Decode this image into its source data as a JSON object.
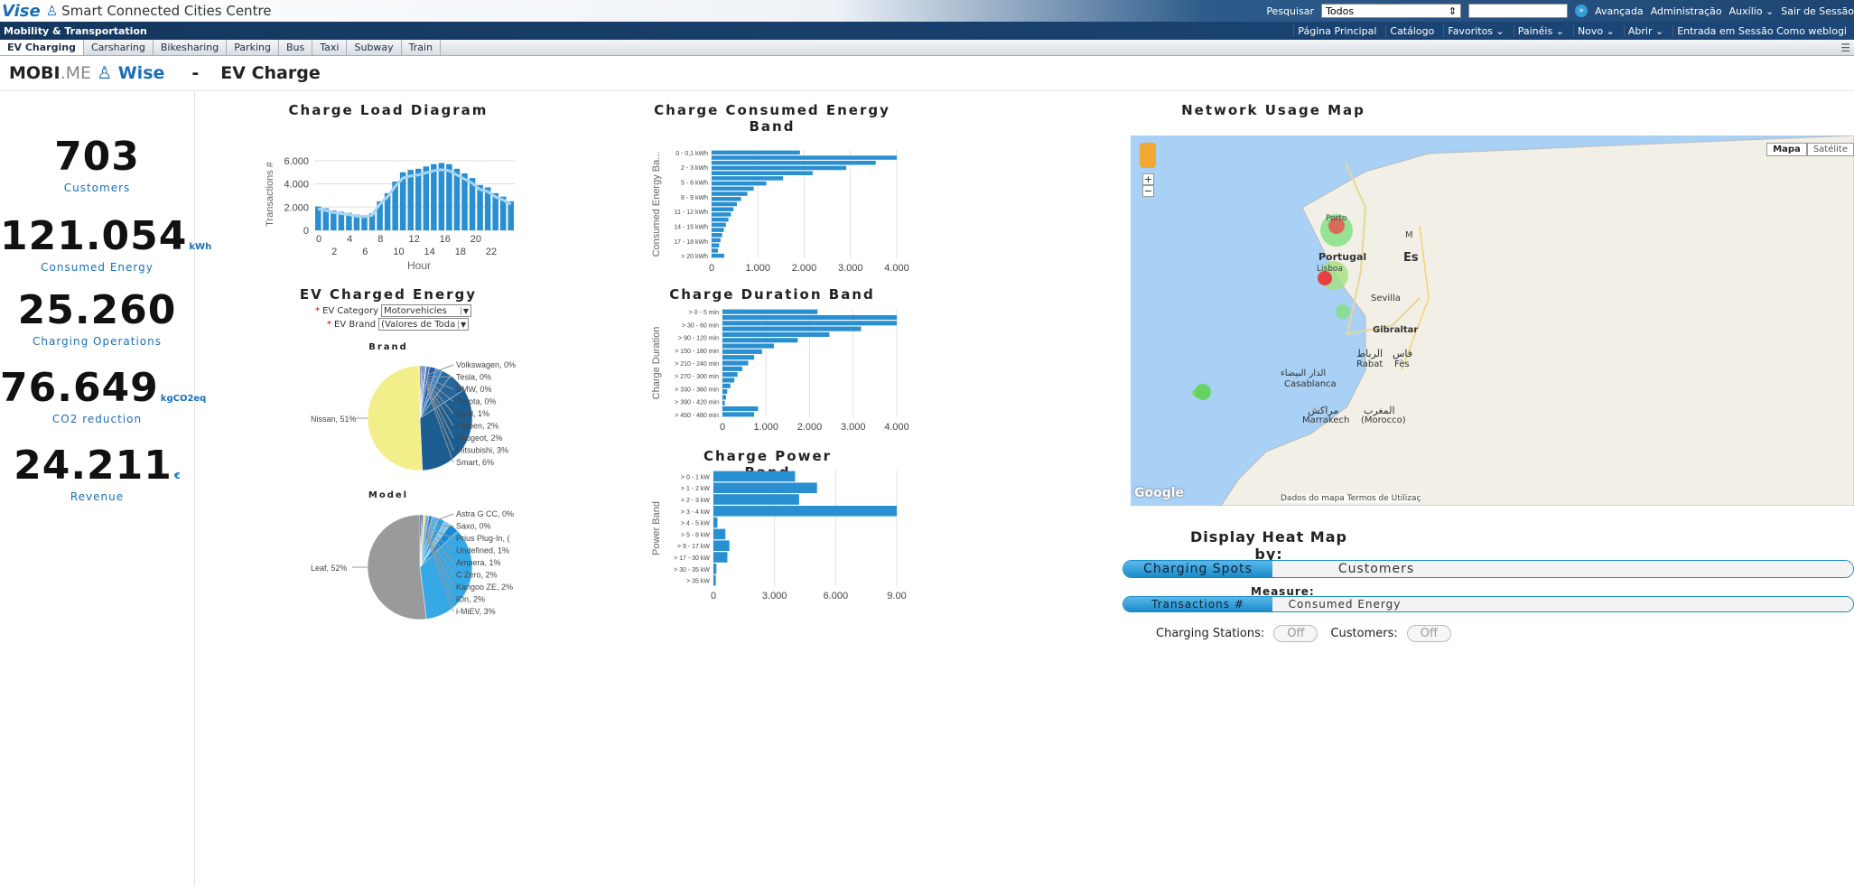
{
  "app": {
    "brand": "Vise",
    "title": "Smart Connected Cities Centre",
    "section": "Mobility & Transportation"
  },
  "search": {
    "label": "Pesquisar",
    "scope": "Todos",
    "advanced": "Avançada",
    "links": [
      "Administração",
      "Auxílio ⌄",
      "Sair de Sessão"
    ]
  },
  "nav2": [
    "Página Principal",
    "Catálogo",
    "Favoritos ⌄",
    "Painéis ⌄",
    "Novo ⌄",
    "Abrir ⌄",
    "Entrada em Sessão Como weblogi"
  ],
  "tabs": [
    "EV Charging",
    "Carsharing",
    "Bikesharing",
    "Parking",
    "Bus",
    "Taxi",
    "Subway",
    "Train"
  ],
  "header": {
    "mobi": "MOBI",
    "me": ".ME",
    "wise": "Wise",
    "dash": "-",
    "page": "EV Charge"
  },
  "kpis": [
    {
      "value": "703",
      "unit": "",
      "label": "Customers"
    },
    {
      "value": "121.054",
      "unit": "kWh",
      "label": "Consumed Energy"
    },
    {
      "value": "25.260",
      "unit": "",
      "label": "Charging Operations"
    },
    {
      "value": "76.649",
      "unit": "kgCO2eq",
      "label": "CO2 reduction"
    },
    {
      "value": "24.211",
      "unit": "€",
      "label": "Revenue"
    }
  ],
  "titles": {
    "load": "Charge Load Diagram",
    "energy_band": "Charge Consumed Energy Band",
    "map": "Network Usage Map",
    "ev_charged": "EV Charged Energy",
    "duration": "Charge Duration Band",
    "power": "Charge Power Band",
    "brand": "Brand",
    "model": "Model"
  },
  "filters": {
    "category_label": "EV Category",
    "category_value": "Motorvehicles",
    "brand_label": "EV Brand",
    "brand_value": "(Valores de Todas as"
  },
  "chart_data": [
    {
      "type": "bar",
      "title": "Charge Load Diagram",
      "xlabel": "Hour",
      "ylabel": "Transactions #",
      "ylim": [
        0,
        7000
      ],
      "yticks": [
        "0",
        "2.000",
        "4.000",
        "6.000"
      ],
      "xticks_top": [
        "0",
        "4",
        "8",
        "12",
        "16",
        "20"
      ],
      "xticks_bottom": [
        "2",
        "6",
        "10",
        "14",
        "18",
        "22"
      ],
      "values": [
        2050,
        1900,
        1700,
        1600,
        1500,
        1350,
        1300,
        1450,
        2500,
        3200,
        4200,
        5000,
        5200,
        5300,
        5500,
        5700,
        5800,
        5700,
        5300,
        4900,
        4500,
        3900,
        3700,
        3200,
        2900,
        2500
      ]
    },
    {
      "type": "bar",
      "title": "Charge Consumed Energy Band",
      "ylabel": "Consumed Energy Ba...",
      "xlim": [
        0,
        4400
      ],
      "xticks": [
        "0",
        "1.000",
        "2.000",
        "3.000",
        "4.000"
      ],
      "categories": [
        "0 - 0,1 kWh",
        "2 - 3 kWh",
        "5 - 6 kWh",
        "8 - 9 kWh",
        "11 - 12 kWh",
        "14 - 15 kWh",
        "17 - 18 kWh",
        "> 20 kWh"
      ],
      "values": [
        2100,
        4400,
        3900,
        3200,
        2400,
        1700,
        1300,
        1000,
        850,
        700,
        600,
        520,
        460,
        400,
        340,
        290,
        250,
        210,
        180,
        150,
        300
      ]
    },
    {
      "type": "bar",
      "title": "Charge Duration Band",
      "ylabel": "Charge Duration",
      "xlim": [
        0,
        4400
      ],
      "xticks": [
        "0",
        "1.000",
        "2.000",
        "3.000",
        "4.000"
      ],
      "categories": [
        "> 0 - 5 min",
        "> 30 - 60 min",
        "> 90 - 120 min",
        "> 150 - 180 min",
        "> 210 - 240 min",
        "> 270 - 300 min",
        "> 330 - 360 min",
        "> 390 - 420 min",
        "> 450 - 480 min"
      ],
      "values": [
        2400,
        4400,
        4400,
        3500,
        2700,
        1900,
        1300,
        1000,
        800,
        650,
        500,
        380,
        300,
        200,
        120,
        90,
        60,
        900,
        800
      ]
    },
    {
      "type": "bar",
      "title": "Charge Power Band",
      "ylabel": "Power Band",
      "xlim": [
        0,
        9200
      ],
      "xticks": [
        "0",
        "3.000",
        "6.000",
        "9.00"
      ],
      "categories": [
        "> 0 - 1 kW",
        "> 1 - 2 kW",
        "> 2 - 3 kW",
        "> 3 - 4 kW",
        "> 4 - 5 kW",
        "> 5 - 8 kW",
        "> 9 - 17 kW",
        "> 17 - 30 kW",
        "> 30 - 35 kW",
        "> 35 kW"
      ],
      "values": [
        4100,
        5200,
        4300,
        9200,
        200,
        600,
        800,
        700,
        150,
        120
      ]
    },
    {
      "type": "pie",
      "title": "Brand",
      "labels": [
        "Nissan, 51%",
        "Volkswagen, 0%",
        "Tesla, 0%",
        "BMW, 0%",
        "Toyota, 0%",
        "Opel, 1%",
        "Citroen, 2%",
        "Peugeot, 2%",
        "Mitsubishi, 3%",
        "Smart, 6%"
      ],
      "values": [
        51,
        0.5,
        0.5,
        0.5,
        0.5,
        1,
        2,
        2,
        3,
        6,
        33.5
      ]
    },
    {
      "type": "pie",
      "title": "Model",
      "labels": [
        "Leaf, 52%",
        "Astra G CC, 0%",
        "Saxo, 0%",
        "Prius Plug-In, (",
        "Undefined, 1%",
        "Ampera, 1%",
        "C Zero, 2%",
        "Kangoo ZE, 2%",
        "iOn, 2%",
        "i-MiEV, 3%"
      ],
      "values": [
        52,
        0.5,
        0.5,
        0.8,
        1,
        1,
        2,
        2,
        2,
        3,
        35.2
      ]
    }
  ],
  "map": {
    "btn_map": "Mapa",
    "btn_sat": "Satélite",
    "labels": [
      "Porto",
      "Portugal",
      "Lisboa",
      "Es",
      "Sevilla",
      "Gibraltar",
      "الرباط",
      "Rabat",
      "فاس",
      "Fès",
      "الدار البيضاء",
      "Casablanca",
      "مراكش",
      "Marrakech",
      "المغرب",
      "(Morocco)",
      "M"
    ],
    "footer": "Dados do mapa  Termos de Utilizaç",
    "google": "Google"
  },
  "heatmap": {
    "title": "Display Heat Map by:",
    "by": [
      "Charging Spots",
      "Customers"
    ],
    "measure_label": "Measure:",
    "measure": [
      "Transactions #",
      "Consumed Energy"
    ],
    "stations_label": "Charging Stations:",
    "customers_label": "Customers:",
    "off": "Off"
  }
}
